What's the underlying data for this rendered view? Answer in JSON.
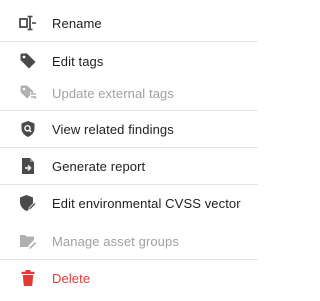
{
  "menu": {
    "items": [
      {
        "label": "Rename",
        "icon": "rename-icon",
        "enabled": true
      },
      {
        "label": "Edit tags",
        "icon": "tag-icon",
        "enabled": true
      },
      {
        "label": "Update external tags",
        "icon": "tag-sync-icon",
        "enabled": false
      },
      {
        "label": "View related findings",
        "icon": "shield-search-icon",
        "enabled": true
      },
      {
        "label": "Generate report",
        "icon": "report-export-icon",
        "enabled": true
      },
      {
        "label": "Edit environmental CVSS vector",
        "icon": "shield-edit-icon",
        "enabled": true
      },
      {
        "label": "Manage asset groups",
        "icon": "folder-edit-icon",
        "enabled": false
      },
      {
        "label": "Delete",
        "icon": "trash-icon",
        "enabled": true
      }
    ]
  },
  "colors": {
    "text": "#212121",
    "icon": "#4a4a4a",
    "disabled": "#a0a0a0",
    "danger": "#e53935",
    "divider": "#e3e3e3"
  }
}
